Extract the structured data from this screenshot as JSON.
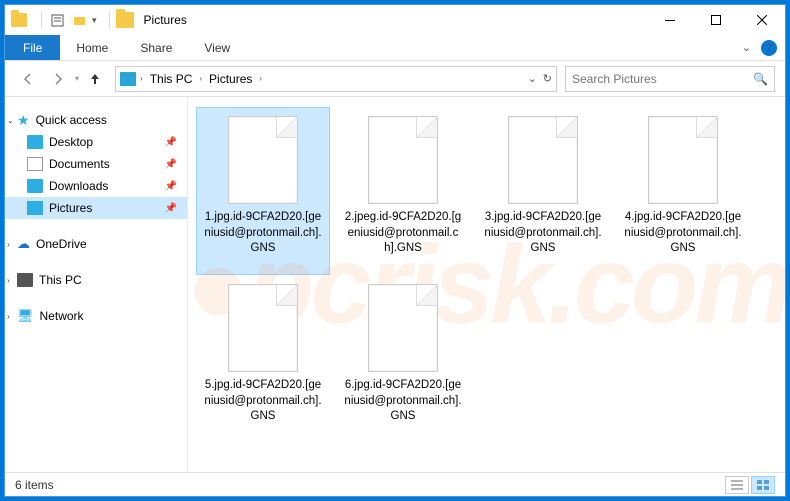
{
  "window": {
    "title": "Pictures",
    "ribbon": {
      "file": "File",
      "tabs": [
        "Home",
        "Share",
        "View"
      ]
    }
  },
  "address": {
    "crumbs": [
      "This PC",
      "Pictures"
    ]
  },
  "search": {
    "placeholder": "Search Pictures"
  },
  "sidebar": {
    "quick_access": "Quick access",
    "items": [
      {
        "label": "Desktop",
        "icon": "ic-desktop",
        "pinned": true
      },
      {
        "label": "Documents",
        "icon": "ic-doc",
        "pinned": true
      },
      {
        "label": "Downloads",
        "icon": "ic-download",
        "pinned": true
      },
      {
        "label": "Pictures",
        "icon": "ic-pic",
        "pinned": true,
        "active": true
      }
    ],
    "onedrive": "OneDrive",
    "thispc": "This PC",
    "network": "Network"
  },
  "files": [
    {
      "name": "1.jpg.id-9CFA2D20.[geniusid@protonmail.ch].GNS",
      "selected": true
    },
    {
      "name": "2.jpeg.id-9CFA2D20.[geniusid@protonmail.ch].GNS"
    },
    {
      "name": "3.jpg.id-9CFA2D20.[geniusid@protonmail.ch].GNS"
    },
    {
      "name": "4.jpg.id-9CFA2D20.[geniusid@protonmail.ch].GNS"
    },
    {
      "name": "5.jpg.id-9CFA2D20.[geniusid@protonmail.ch].GNS"
    },
    {
      "name": "6.jpg.id-9CFA2D20.[geniusid@protonmail.ch].GNS"
    }
  ],
  "status": {
    "count": "6 items"
  },
  "watermark": "pcrisk.com"
}
